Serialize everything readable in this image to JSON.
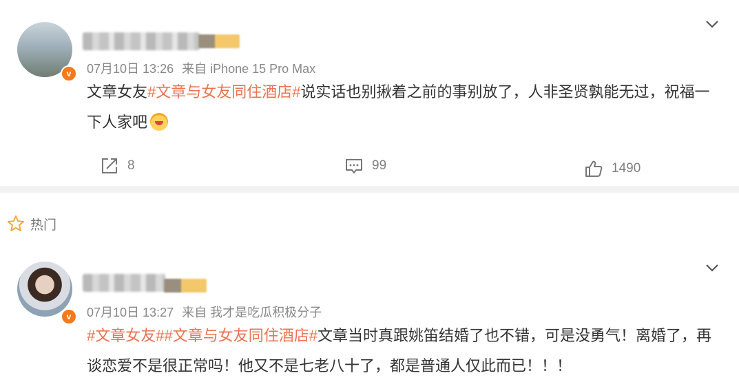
{
  "posts": [
    {
      "time": "07月10日 13:26",
      "source": "来自 iPhone 15 Pro Max",
      "text_parts": {
        "p1": "文章女友",
        "p2": "#文章与女友同住酒店#",
        "p3": "说实话也别揪着之前的事别放了，人非圣贤孰能无过，祝福一下人家吧"
      },
      "emoji": "heart-hug-emoji",
      "reposts": "8",
      "comments": "99",
      "likes": "1490"
    },
    {
      "time": "07月10日 13:27",
      "source": "来自 我才是吃瓜积极分子",
      "text_parts": {
        "p1": "#文章女友#",
        "p2": "#文章与女友同住酒店#",
        "p3": "文章当时真跟姚笛结婚了也不错，可是没勇气！离婚了，再谈恋爱不是很正常吗！他又不是七老八十了，都是普通人仅此而已！！！"
      }
    }
  ],
  "section": {
    "hot_label": "热门"
  },
  "badge_label": "v",
  "colors": {
    "tag": "#eb7350",
    "badge": "#f47a1b",
    "hot_star": "#f2a93b"
  }
}
